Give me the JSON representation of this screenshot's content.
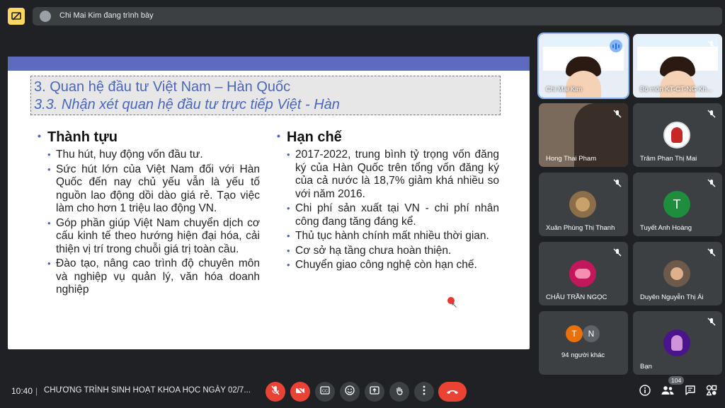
{
  "topbar": {
    "presenting_text": "Chi Mai Kim đang trình bày"
  },
  "slide": {
    "title1": "3. Quan hệ đầu tư Việt Nam – Hàn Quốc",
    "title2": "3.3. Nhận xét quan hệ đầu tư trực tiếp Việt - Hàn",
    "left": {
      "heading": "Thành tựu",
      "items": [
        "Thu hút, huy động vốn đầu tư.",
        "Sức hút lớn của Việt Nam đối với Hàn Quốc đến nay chủ yếu vẫn là yếu tố nguồn lao động dồi dào giá rẻ. Tạo việc làm cho hơn 1 triệu lao động VN.",
        "Góp phần giúp Việt Nam chuyển dịch cơ cấu kinh tế theo hướng hiện đại hóa, cải thiện vị trí trong chuỗi giá trị toàn cầu.",
        "Đào tạo, nâng cao trình độ chuyên môn và nghiệp vụ quản lý, văn hóa doanh nghiệp"
      ]
    },
    "right": {
      "heading": "Hạn chế",
      "items": [
        "2017-2022, trung bình tỷ trọng vốn đăng ký của Hàn Quốc trên tổng vốn đăng ký của cả nước là 18,7% giảm khá nhiều so với năm 2016.",
        "Chi phí sản xuất tại VN - chi phí nhân công đang tăng đáng kể.",
        "Thủ tục hành chính mất nhiều thời gian.",
        "Cơ sở hạ tầng chưa hoàn thiện.",
        "Chuyển giao công nghệ còn hạn chế."
      ]
    }
  },
  "participants": {
    "tiles": [
      {
        "name": "Chi Mai Kim"
      },
      {
        "name": "Bộ môn KT-CT-NG Kh..."
      },
      {
        "name": "Hong Thai Pham"
      },
      {
        "name": "Trâm Phan Thị Mai"
      },
      {
        "name": "Xuân Phùng Thị Thanh"
      },
      {
        "name": "Tuyết Anh Hoàng",
        "initial": "T"
      },
      {
        "name": "CHÂU TRẦN NGỌC"
      },
      {
        "name": "Duyên Nguyễn Thị Ái"
      },
      {
        "name": "94 người khác",
        "initials": [
          "T",
          "N"
        ]
      },
      {
        "name": "Bạn"
      }
    ]
  },
  "bottombar": {
    "time": "10:40",
    "separator": "|",
    "meeting_title": "CHƯƠNG TRÌNH SINH HOẠT KHOA HỌC NGÀY 02/7...",
    "participant_count": "104"
  },
  "colors": {
    "background": "#202124",
    "tile": "#3c4043",
    "danger": "#ea4335",
    "accent": "#8ab4f8",
    "present_icon": "#fdd663"
  },
  "icons": [
    "present-icon",
    "mic-off-icon",
    "camera-off-icon",
    "captions-icon",
    "emoji-icon",
    "present-screen-icon",
    "raise-hand-icon",
    "more-options-icon",
    "end-call-icon",
    "info-icon",
    "people-icon",
    "chat-icon",
    "activities-icon"
  ]
}
